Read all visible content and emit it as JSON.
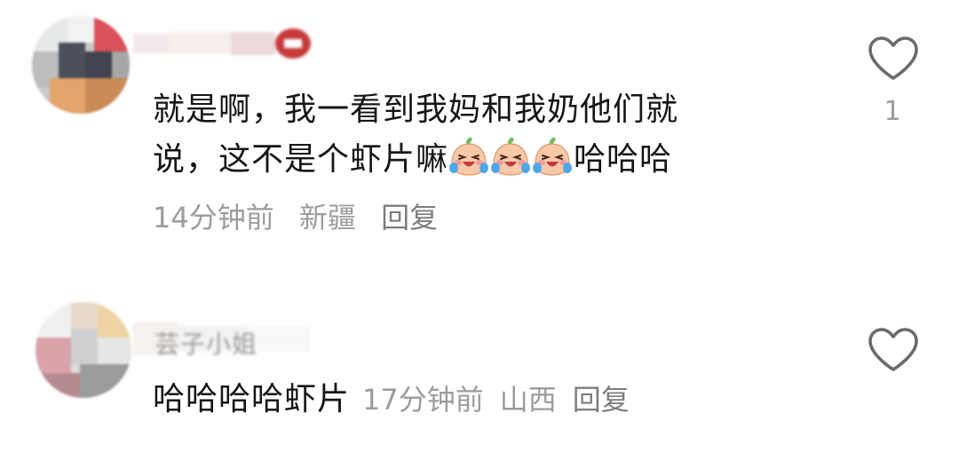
{
  "comments": [
    {
      "username": "",
      "text_line1": "就是啊，我一看到我妈和我奶他们就",
      "text_line2": "说，这不是个虾片嘛",
      "text_suffix": "哈哈哈",
      "emoji": [
        "crying-laughing-peach-emoji",
        "crying-laughing-peach-emoji",
        "crying-laughing-peach-emoji"
      ],
      "time": "14分钟前",
      "location": "新疆",
      "reply": "回复",
      "likes": "1"
    },
    {
      "username": "芸子小姐",
      "text": "哈哈哈哈虾片",
      "time": "17分钟前",
      "location": "山西",
      "reply": "回复",
      "likes": ""
    }
  ],
  "colors": {
    "text": "#161616",
    "meta": "#9c9c9c",
    "icon": "#6b6b6b"
  }
}
